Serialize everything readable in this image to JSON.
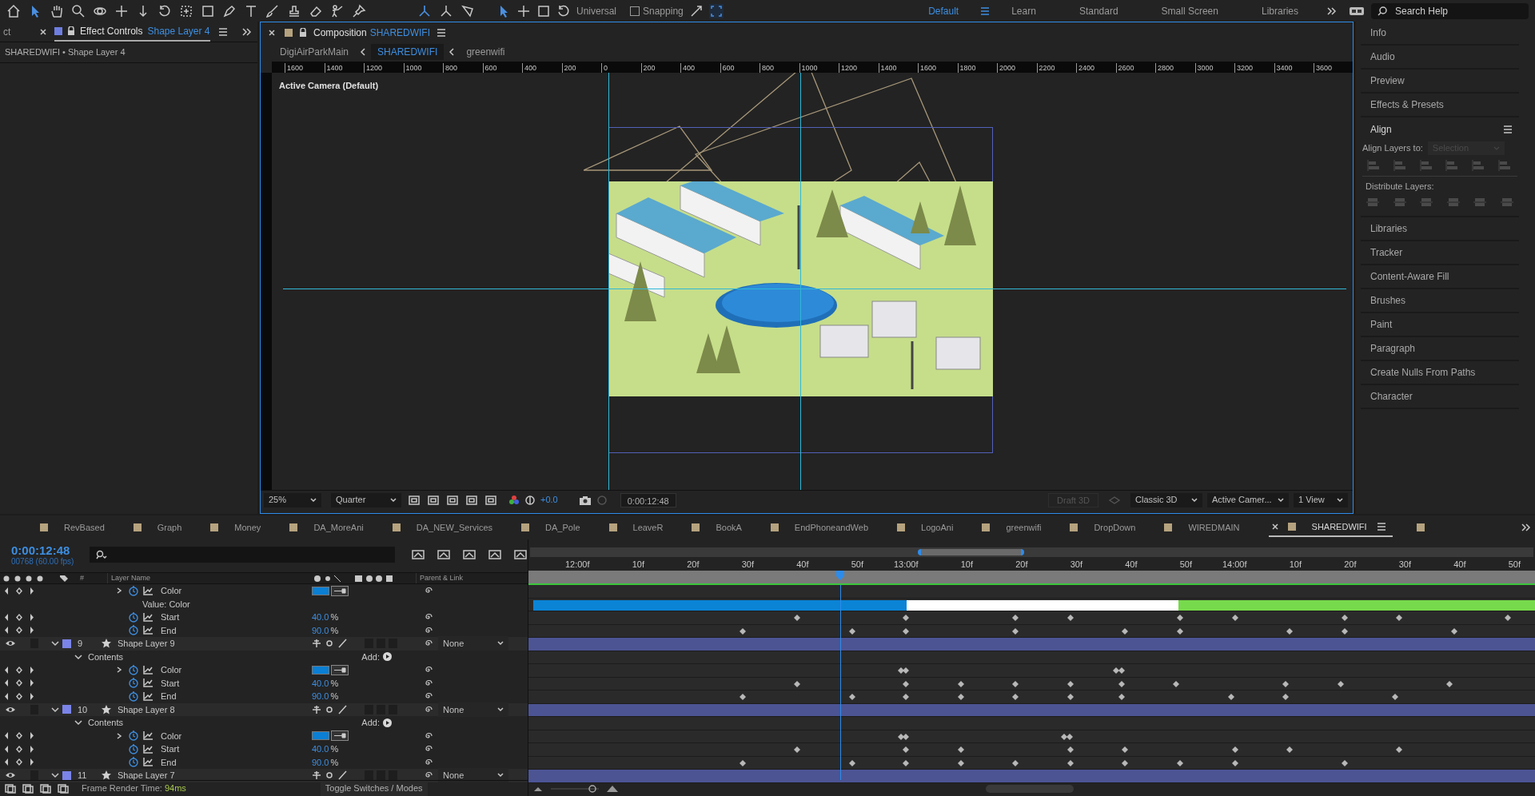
{
  "toolbar": {
    "axis_mode": "Universal",
    "snapping": {
      "label": "Snapping",
      "checked": false
    },
    "workspaces": [
      {
        "label": "Default",
        "selected": true
      },
      {
        "label": "Learn",
        "selected": false
      },
      {
        "label": "Standard",
        "selected": false
      },
      {
        "label": "Small Screen",
        "selected": false
      },
      {
        "label": "Libraries",
        "selected": false
      }
    ],
    "search": {
      "placeholder": "Search Help"
    }
  },
  "effect_controls": {
    "tab_fragment": "ct",
    "title": "Effect Controls",
    "layer": "Shape Layer 4",
    "subtitle": "SHAREDWIFI • Shape Layer 4"
  },
  "composition": {
    "title": "Composition",
    "name": "SHAREDWIFI",
    "breadcrumbs": [
      {
        "label": "DigiAirParkMain",
        "selected": false
      },
      {
        "label": "SHAREDWIFI",
        "selected": true
      },
      {
        "label": "greenwifi",
        "selected": false
      }
    ],
    "ruler_labels": [
      "1600",
      "1400",
      "1200",
      "1000",
      "800",
      "600",
      "400",
      "200",
      "0",
      "200",
      "400",
      "600",
      "800",
      "1000",
      "1200",
      "1400",
      "1600",
      "1800",
      "2000",
      "2200",
      "2400",
      "2600",
      "2800",
      "3000",
      "3200",
      "3400",
      "3600"
    ],
    "camera_label": "Active Camera (Default)",
    "footer": {
      "zoom": "25%",
      "resolution": "Quarter",
      "exposure": "+0.0",
      "timecode": "0:00:12:48",
      "draft": "Draft 3D",
      "renderer": "Classic 3D",
      "view": "Active Camer...",
      "layout": "1 View"
    }
  },
  "panels": [
    {
      "kind": "item",
      "label": "Info"
    },
    {
      "kind": "item",
      "label": "Audio"
    },
    {
      "kind": "item",
      "label": "Preview"
    },
    {
      "kind": "item",
      "label": "Effects & Presets"
    },
    {
      "kind": "align",
      "label": "Align",
      "align_to_label": "Align Layers to:",
      "align_to_placeholder": "Selection",
      "distribute_label": "Distribute Layers:"
    },
    {
      "kind": "item",
      "label": "Libraries"
    },
    {
      "kind": "item",
      "label": "Tracker"
    },
    {
      "kind": "item",
      "label": "Content-Aware Fill"
    },
    {
      "kind": "item",
      "label": "Brushes"
    },
    {
      "kind": "item",
      "label": "Paint"
    },
    {
      "kind": "item",
      "label": "Paragraph"
    },
    {
      "kind": "item",
      "label": "Create Nulls From Paths"
    },
    {
      "kind": "item",
      "label": "Character"
    }
  ],
  "timeline": {
    "tabs": [
      {
        "label": "RevBased",
        "selected": false
      },
      {
        "label": "Graph",
        "selected": false
      },
      {
        "label": "Money",
        "selected": false
      },
      {
        "label": "DA_MoreAni",
        "selected": false
      },
      {
        "label": "DA_NEW_Services",
        "selected": false
      },
      {
        "label": "DA_Pole",
        "selected": false
      },
      {
        "label": "LeaveR",
        "selected": false
      },
      {
        "label": "BookA",
        "selected": false
      },
      {
        "label": "EndPhoneandWeb",
        "selected": false
      },
      {
        "label": "LogoAni",
        "selected": false
      },
      {
        "label": "greenwifi",
        "selected": false
      },
      {
        "label": "DropDown",
        "selected": false
      },
      {
        "label": "WIREDMAIN",
        "selected": false
      },
      {
        "label": "SHAREDWIFI",
        "selected": true
      }
    ],
    "timecode": "0:00:12:48",
    "frame_info": "00768 (60.00 fps)",
    "columns": {
      "number": "#",
      "layer_name": "Layer Name",
      "parent": "Parent & Link"
    },
    "time_labels": [
      "12:00f",
      "10f",
      "20f",
      "30f",
      "40f",
      "50f",
      "13:00f",
      "10f",
      "20f",
      "30f",
      "40f",
      "50f",
      "14:00f",
      "10f",
      "20f",
      "30f",
      "40f",
      "50f"
    ],
    "rows": [
      {
        "kind": "property",
        "name": "Color",
        "color": "#0a7fd4",
        "expandable": true
      },
      {
        "kind": "value",
        "name": "Value: Color"
      },
      {
        "kind": "property",
        "name": "Start",
        "value": "40.0",
        "unit": "%"
      },
      {
        "kind": "property",
        "name": "End",
        "value": "90.0",
        "unit": "%"
      },
      {
        "kind": "layer",
        "number": "9",
        "name": "Shape Layer 9",
        "parent": "None",
        "expanded": true
      },
      {
        "kind": "group",
        "name": "Contents",
        "add_label": "Add:"
      },
      {
        "kind": "property",
        "name": "Color",
        "color": "#0a7fd4",
        "expandable": true
      },
      {
        "kind": "property",
        "name": "Start",
        "value": "40.0",
        "unit": "%"
      },
      {
        "kind": "property",
        "name": "End",
        "value": "90.0",
        "unit": "%"
      },
      {
        "kind": "layer",
        "number": "10",
        "name": "Shape Layer 8",
        "parent": "None",
        "expanded": true
      },
      {
        "kind": "group",
        "name": "Contents",
        "add_label": "Add:"
      },
      {
        "kind": "property",
        "name": "Color",
        "color": "#0a7fd4",
        "expandable": true
      },
      {
        "kind": "property",
        "name": "Start",
        "value": "40.0",
        "unit": "%"
      },
      {
        "kind": "property",
        "name": "End",
        "value": "90.0",
        "unit": "%"
      },
      {
        "kind": "layer",
        "number": "11",
        "name": "Shape Layer 7",
        "parent": "None",
        "expanded": true
      }
    ],
    "render_label": "Frame Render Time:",
    "render_time": "94ms",
    "toggle_label": "Toggle Switches / Modes"
  }
}
